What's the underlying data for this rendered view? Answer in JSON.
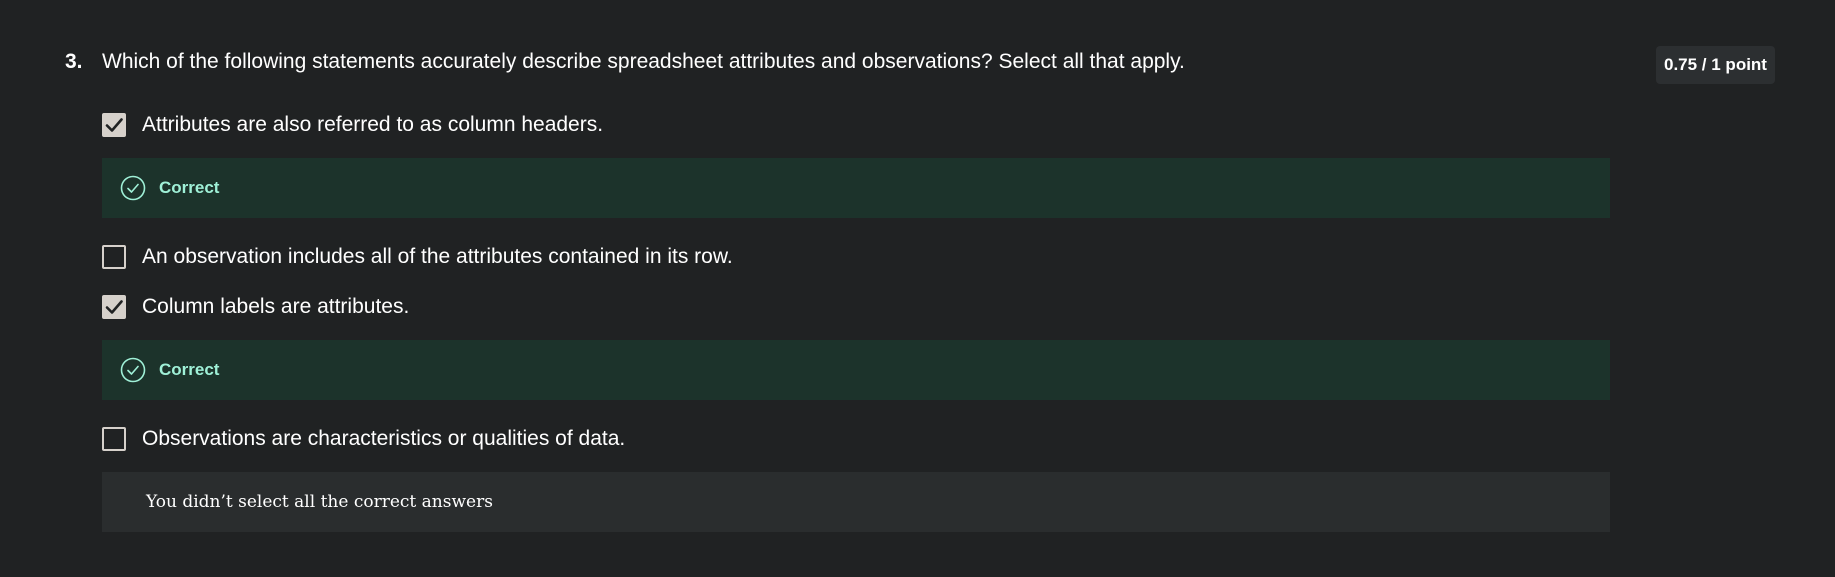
{
  "question": {
    "number": "3.",
    "text": "Which of the following statements accurately describe spreadsheet attributes and observations? Select all that apply.",
    "score": "0.75 / 1 point"
  },
  "options": [
    {
      "label": "Attributes are also referred to as column headers.",
      "checked": true,
      "feedback": "Correct"
    },
    {
      "label": "An observation includes all of the attributes contained in its row.",
      "checked": false
    },
    {
      "label": "Column labels are attributes.",
      "checked": true,
      "feedback": "Correct"
    },
    {
      "label": "Observations are characteristics or qualities of data.",
      "checked": false
    }
  ],
  "summary": "You didn’t select all the correct answers",
  "colors": {
    "background": "#202223",
    "correct_bg": "#1c332b",
    "correct_text": "#9ff0d7",
    "checkbox": "#d6d1cb",
    "summary_bg": "#2a2d2e"
  }
}
